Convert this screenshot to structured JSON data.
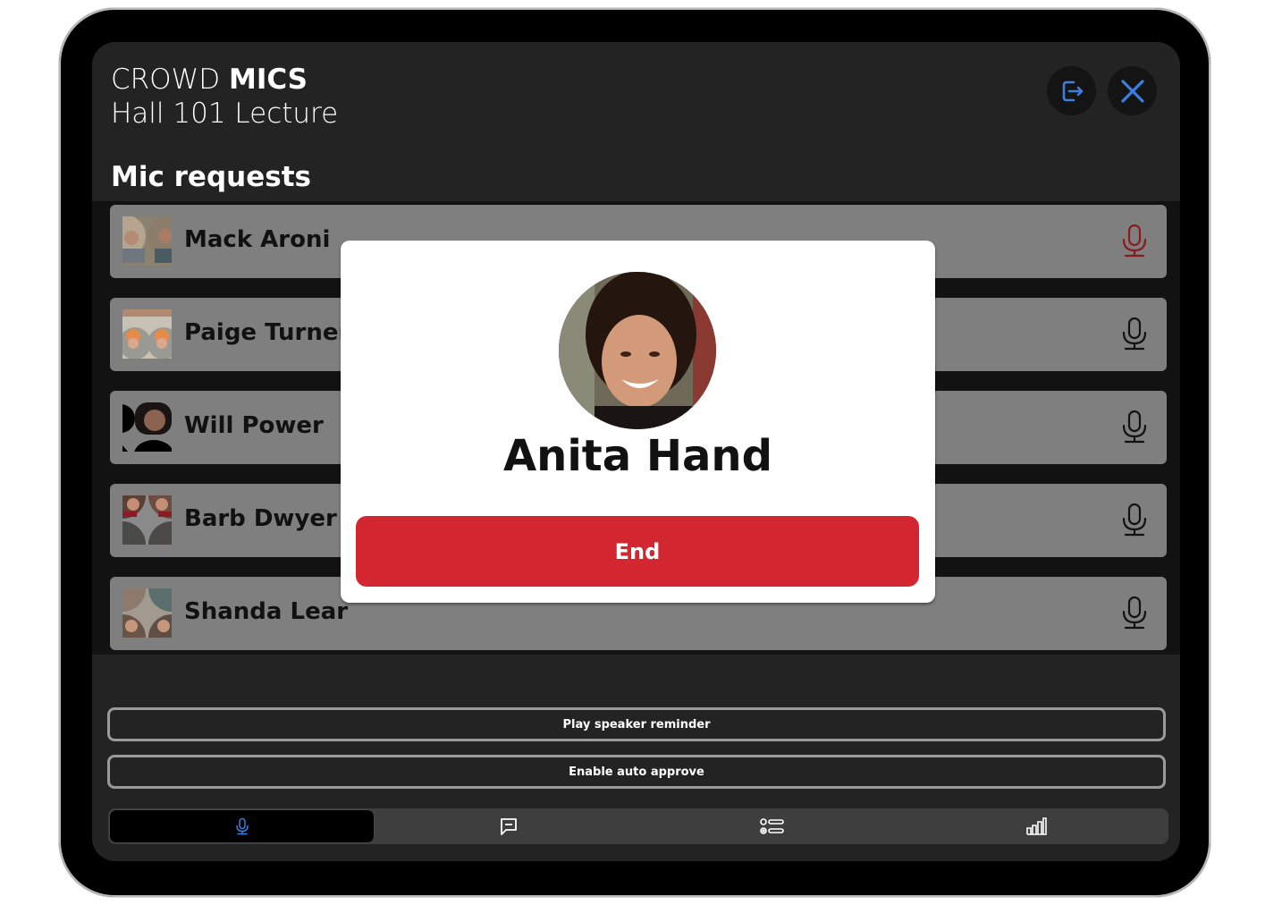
{
  "app": {
    "brand_light": "CROWD",
    "brand_bold": "MICS",
    "event_title": "Hall 101 Lecture"
  },
  "header": {
    "exit_icon": "exit-icon",
    "close_icon": "close-icon"
  },
  "section_title": "Mic requests",
  "mic_requests": [
    {
      "name": "Mack Aroni",
      "mic_state": "active",
      "mic_color": "#8b1a1f"
    },
    {
      "name": "Paige Turner",
      "mic_state": "idle",
      "mic_color": "#111111"
    },
    {
      "name": "Will Power",
      "mic_state": "idle",
      "mic_color": "#111111"
    },
    {
      "name": "Barb Dwyer",
      "mic_state": "idle",
      "mic_color": "#111111"
    },
    {
      "name": "Shanda Lear",
      "mic_state": "idle",
      "mic_color": "#111111"
    }
  ],
  "modal": {
    "speaker_name": "Anita Hand",
    "end_label": "End"
  },
  "actions": {
    "play_reminder_label": "Play speaker reminder",
    "auto_approve_label": "Enable auto approve"
  },
  "tabs": [
    {
      "id": "mic",
      "icon": "microphone-icon",
      "active": true
    },
    {
      "id": "chat",
      "icon": "chat-icon",
      "active": false
    },
    {
      "id": "polls",
      "icon": "checklist-icon",
      "active": false
    },
    {
      "id": "stats",
      "icon": "bar-chart-icon",
      "active": false
    }
  ],
  "colors": {
    "accent_blue": "#3d7fe0",
    "danger_red": "#d22630",
    "active_mic_red": "#8b1a1f"
  }
}
